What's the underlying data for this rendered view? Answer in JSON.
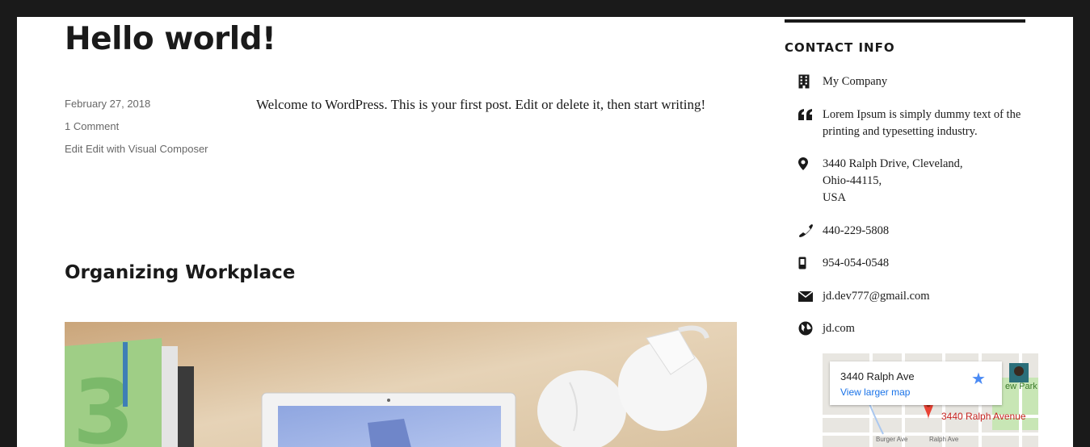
{
  "post": {
    "title": "Hello world!",
    "date": "February 27, 2018",
    "comments": "1 Comment",
    "edit": "Edit Edit with Visual Composer",
    "content": "Welcome to WordPress. This is your first post. Edit or delete it, then start writing!"
  },
  "post2": {
    "title": "Organizing Workplace"
  },
  "widget": {
    "title": "CONTACT INFO",
    "company": "My Company",
    "about": "Lorem Ipsum is simply dummy text of the printing and typesetting industry.",
    "address_line1": "3440 Ralph Drive, Cleveland,",
    "address_line2": "Ohio-44115,",
    "address_line3": "USA",
    "phone": "440-229-5808",
    "mobile": "954-054-0548",
    "email": "jd.dev777@gmail.com",
    "website": "jd.com",
    "icons": [
      "building-icon",
      "quote-icon",
      "map-pin-icon",
      "phone-icon",
      "mobile-icon",
      "mail-icon",
      "globe-icon"
    ]
  },
  "map": {
    "card_address": "3440 Ralph Ave",
    "larger_link": "View larger map",
    "pin_label": "3440 Ralph Avenue",
    "park_label": "ew Park",
    "street1": "Burger Ave",
    "street2": "Ralph Ave"
  },
  "colors": {
    "link": "#007acc",
    "frame": "#1a1a1a"
  }
}
